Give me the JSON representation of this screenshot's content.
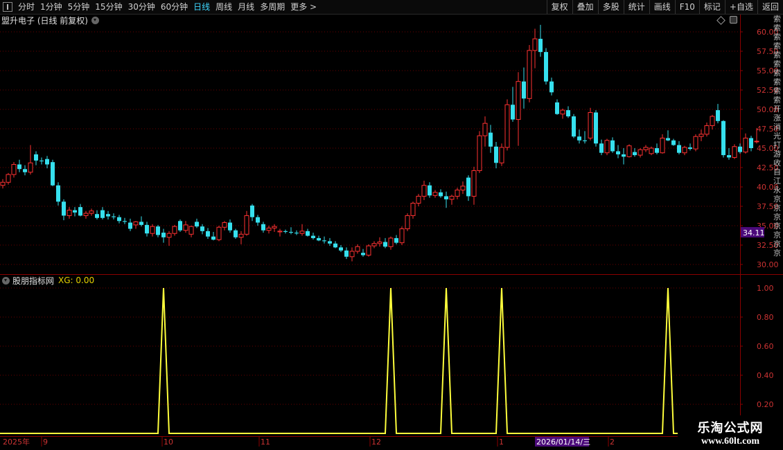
{
  "toolbar": {
    "periods": [
      "分时",
      "1分钟",
      "5分钟",
      "15分钟",
      "30分钟",
      "60分钟",
      "日线",
      "周线",
      "月线",
      "多周期",
      "更多 >"
    ],
    "active_period": "日线",
    "right_buttons": [
      "复权",
      "叠加",
      "多股",
      "统计",
      "画线",
      "F10",
      "标记",
      "+自选",
      "返回"
    ]
  },
  "chart_header": {
    "title": "盟升电子 (日线 前复权)"
  },
  "indicator_header": {
    "name": "股朋指标网",
    "value_text": "XG: 0.00"
  },
  "price_axis": {
    "ticks": [
      "60.00",
      "57.50",
      "55.00",
      "52.50",
      "50.00",
      "47.50",
      "45.00",
      "42.50",
      "40.00",
      "37.50",
      "35.00",
      "32.50",
      "30.00"
    ],
    "current_price": "34.11"
  },
  "indicator_axis": {
    "ticks": [
      "1.00",
      "0.80",
      "0.60",
      "0.40",
      "0.20"
    ]
  },
  "time_axis": {
    "labels": [
      "2025年",
      "9",
      "10",
      "11",
      "12",
      "1",
      "2"
    ],
    "cursor_date": "2026/01/14/三"
  },
  "right_strip": {
    "text": "索索索索索索索索索索开涨消光打游收自江永京京京京京京京"
  },
  "watermark": {
    "line1": "乐淘公式网",
    "line2": "www.60lt.com"
  },
  "colors": {
    "up": "#ff3232",
    "down": "#36e0ee",
    "indicator_line": "#ffff3c",
    "grid": "#6b0000",
    "axis_text": "#cc3333",
    "cursor_box": "#4b0a7a"
  },
  "chart_data": [
    {
      "type": "candlestick",
      "title": "盟升电子 (日线 前复权)",
      "ylim": [
        30,
        60
      ],
      "candles": [
        [
          40.2,
          41.0,
          39.8,
          40.6
        ],
        [
          40.6,
          41.8,
          40.3,
          41.6
        ],
        [
          41.6,
          43.2,
          41.2,
          42.9
        ],
        [
          42.9,
          43.5,
          41.9,
          42.3
        ],
        [
          42.3,
          42.8,
          41.5,
          41.9
        ],
        [
          41.9,
          45.4,
          41.6,
          43.1
        ],
        [
          44.2,
          44.6,
          42.8,
          43.4
        ],
        [
          43.4,
          43.8,
          42.9,
          43.3
        ],
        [
          43.6,
          44.0,
          42.4,
          42.9
        ],
        [
          43.2,
          43.5,
          40.1,
          40.2
        ],
        [
          40.2,
          40.6,
          37.6,
          38.1
        ],
        [
          38.1,
          38.4,
          35.7,
          36.3
        ],
        [
          36.3,
          37.4,
          35.9,
          37.0
        ],
        [
          37.0,
          37.4,
          36.2,
          36.7
        ],
        [
          37.4,
          37.8,
          36.2,
          36.3
        ],
        [
          36.3,
          36.9,
          35.9,
          36.6
        ],
        [
          36.6,
          37.2,
          36.3,
          36.9
        ],
        [
          36.5,
          37.0,
          35.8,
          36.0
        ],
        [
          37.0,
          37.4,
          35.8,
          36.0
        ],
        [
          36.5,
          36.9,
          35.8,
          36.2
        ],
        [
          36.2,
          36.6,
          35.8,
          36.1
        ],
        [
          36.1,
          36.4,
          35.3,
          35.6
        ],
        [
          35.6,
          36.0,
          35.2,
          35.5
        ],
        [
          35.4,
          35.9,
          34.3,
          34.6
        ],
        [
          35.1,
          35.6,
          34.6,
          35.5
        ],
        [
          35.5,
          36.2,
          34.9,
          35.1
        ],
        [
          35.1,
          35.5,
          33.6,
          34.0
        ],
        [
          34.0,
          35.2,
          33.6,
          34.9
        ],
        [
          34.9,
          35.1,
          33.5,
          33.8
        ],
        [
          34.1,
          34.6,
          32.8,
          33.5
        ],
        [
          33.5,
          34.3,
          32.4,
          34.0
        ],
        [
          34.0,
          35.1,
          33.7,
          34.9
        ],
        [
          35.6,
          35.8,
          34.2,
          34.4
        ],
        [
          34.4,
          35.6,
          34.1,
          35.1
        ],
        [
          33.9,
          35.0,
          33.5,
          34.9
        ],
        [
          35.5,
          35.9,
          34.7,
          34.9
        ],
        [
          34.9,
          35.2,
          33.9,
          34.3
        ],
        [
          34.3,
          34.7,
          33.3,
          33.6
        ],
        [
          33.6,
          34.2,
          33.1,
          33.2
        ],
        [
          33.2,
          35.0,
          33.0,
          34.8
        ],
        [
          34.8,
          35.6,
          34.4,
          35.4
        ],
        [
          35.4,
          35.8,
          34.1,
          34.4
        ],
        [
          34.4,
          34.6,
          33.3,
          33.5
        ],
        [
          33.5,
          34.3,
          32.6,
          33.9
        ],
        [
          33.9,
          36.9,
          33.7,
          36.3
        ],
        [
          37.6,
          37.8,
          35.6,
          36.1
        ],
        [
          36.1,
          36.4,
          35.0,
          35.4
        ],
        [
          35.2,
          35.5,
          34.1,
          34.4
        ],
        [
          34.4,
          35.0,
          34.0,
          34.7
        ],
        [
          34.7,
          35.2,
          34.2,
          34.9
        ],
        [
          34.2,
          34.6,
          33.6,
          34.3
        ],
        [
          34.3,
          34.5,
          34.0,
          34.2
        ],
        [
          34.2,
          34.8,
          33.9,
          34.1
        ],
        [
          34.1,
          34.4,
          33.8,
          34.0
        ],
        [
          34.0,
          35.2,
          33.7,
          34.3
        ],
        [
          34.3,
          34.6,
          33.6,
          33.7
        ],
        [
          33.7,
          34.1,
          33.2,
          33.4
        ],
        [
          33.4,
          33.7,
          33.0,
          33.1
        ],
        [
          33.1,
          33.6,
          32.7,
          33.0
        ],
        [
          33.0,
          33.4,
          32.4,
          32.7
        ],
        [
          32.7,
          33.0,
          32.1,
          32.2
        ],
        [
          32.2,
          32.5,
          31.6,
          31.8
        ],
        [
          31.8,
          32.2,
          30.7,
          31.0
        ],
        [
          31.0,
          32.2,
          30.4,
          31.7
        ],
        [
          31.7,
          32.6,
          31.4,
          32.3
        ],
        [
          31.5,
          32.0,
          31.0,
          31.2
        ],
        [
          31.2,
          32.6,
          31.0,
          32.4
        ],
        [
          32.4,
          33.0,
          32.1,
          32.7
        ],
        [
          32.7,
          33.5,
          32.3,
          32.9
        ],
        [
          32.9,
          33.4,
          32.1,
          32.3
        ],
        [
          32.3,
          33.6,
          31.9,
          33.4
        ],
        [
          33.4,
          33.8,
          32.6,
          32.8
        ],
        [
          32.8,
          34.9,
          32.5,
          34.6
        ],
        [
          34.6,
          36.6,
          34.3,
          36.3
        ],
        [
          36.3,
          38.1,
          35.9,
          37.9
        ],
        [
          37.9,
          39.1,
          37.5,
          38.8
        ],
        [
          38.8,
          40.8,
          38.3,
          40.2
        ],
        [
          40.2,
          40.6,
          38.6,
          38.9
        ],
        [
          38.9,
          39.6,
          38.6,
          39.3
        ],
        [
          39.3,
          39.7,
          38.6,
          38.8
        ],
        [
          38.8,
          39.4,
          37.3,
          38.4
        ],
        [
          38.4,
          39.0,
          37.7,
          38.8
        ],
        [
          38.8,
          39.9,
          38.4,
          39.6
        ],
        [
          39.6,
          40.7,
          39.1,
          40.1
        ],
        [
          41.2,
          41.5,
          38.2,
          38.8
        ],
        [
          38.8,
          42.6,
          37.7,
          42.1
        ],
        [
          42.1,
          47.2,
          41.8,
          46.6
        ],
        [
          46.6,
          49.1,
          45.2,
          48.2
        ],
        [
          47.0,
          48.0,
          44.4,
          45.2
        ],
        [
          45.2,
          45.8,
          42.4,
          43.1
        ],
        [
          43.1,
          45.6,
          42.7,
          45.1
        ],
        [
          45.1,
          51.3,
          44.7,
          50.6
        ],
        [
          50.6,
          52.9,
          48.4,
          48.7
        ],
        [
          48.7,
          54.8,
          45.3,
          53.6
        ],
        [
          53.6,
          55.4,
          50.1,
          51.4
        ],
        [
          51.4,
          58.3,
          50.9,
          57.6
        ],
        [
          57.6,
          60.4,
          55.3,
          59.1
        ],
        [
          59.1,
          60.9,
          56.8,
          57.4
        ],
        [
          57.4,
          57.9,
          53.2,
          53.6
        ],
        [
          53.6,
          54.1,
          51.8,
          52.2
        ],
        [
          50.9,
          51.3,
          49.3,
          49.4
        ],
        [
          49.4,
          50.1,
          48.8,
          49.9
        ],
        [
          49.9,
          50.4,
          48.9,
          49.1
        ],
        [
          49.1,
          49.4,
          46.3,
          46.5
        ],
        [
          46.5,
          47.4,
          45.6,
          46.0
        ],
        [
          46.0,
          47.2,
          45.6,
          45.9
        ],
        [
          46.3,
          50.2,
          46.0,
          49.6
        ],
        [
          49.6,
          49.9,
          45.2,
          45.6
        ],
        [
          45.6,
          46.1,
          44.1,
          44.4
        ],
        [
          44.4,
          46.2,
          44.1,
          46.0
        ],
        [
          46.0,
          46.4,
          44.4,
          44.6
        ],
        [
          44.6,
          45.4,
          43.7,
          44.2
        ],
        [
          44.2,
          45.0,
          42.9,
          43.9
        ],
        [
          43.9,
          45.5,
          43.8,
          45.3
        ],
        [
          44.5,
          45.0,
          43.9,
          44.1
        ],
        [
          44.1,
          45.0,
          43.8,
          44.8
        ],
        [
          44.8,
          45.4,
          44.5,
          45.1
        ],
        [
          44.3,
          45.2,
          44.1,
          45.0
        ],
        [
          45.0,
          45.6,
          44.2,
          44.4
        ],
        [
          44.4,
          46.8,
          44.3,
          46.3
        ],
        [
          46.3,
          47.3,
          45.9,
          46.0
        ],
        [
          46.0,
          46.2,
          45.3,
          45.4
        ],
        [
          45.4,
          45.9,
          44.2,
          44.4
        ],
        [
          44.4,
          45.3,
          44.1,
          45.1
        ],
        [
          45.1,
          45.6,
          44.7,
          44.9
        ],
        [
          44.9,
          46.8,
          44.6,
          46.5
        ],
        [
          46.5,
          47.4,
          45.9,
          46.8
        ],
        [
          46.8,
          48.3,
          46.5,
          47.9
        ],
        [
          47.9,
          49.3,
          47.4,
          49.1
        ],
        [
          49.9,
          50.7,
          48.2,
          48.5
        ],
        [
          48.5,
          48.6,
          43.8,
          44.1
        ],
        [
          44.1,
          45.0,
          43.5,
          43.8
        ],
        [
          43.8,
          45.5,
          43.6,
          45.2
        ],
        [
          45.2,
          45.6,
          44.3,
          44.5
        ],
        [
          44.5,
          46.9,
          44.3,
          46.3
        ],
        [
          46.3,
          46.6,
          44.6,
          45.0
        ],
        [
          45.9,
          47.6,
          45.6,
          45.9
        ]
      ]
    },
    {
      "type": "line",
      "title": "股朋指标网",
      "series": [
        {
          "name": "XG",
          "values": [
            0,
            0,
            0,
            0,
            0,
            0,
            0,
            0,
            0,
            0,
            0,
            0,
            0,
            0,
            0,
            0,
            0,
            0,
            0,
            0,
            0,
            0,
            0,
            0,
            0,
            0,
            0,
            0,
            0,
            1,
            0,
            0,
            0,
            0,
            0,
            0,
            0,
            0,
            0,
            0,
            0,
            0,
            0,
            0,
            0,
            0,
            0,
            0,
            0,
            0,
            0,
            0,
            0,
            0,
            0,
            0,
            0,
            0,
            0,
            0,
            0,
            0,
            0,
            0,
            0,
            0,
            0,
            0,
            0,
            0,
            1,
            0,
            0,
            0,
            0,
            0,
            0,
            0,
            0,
            0,
            1,
            0,
            0,
            0,
            0,
            0,
            0,
            0,
            0,
            0,
            1,
            0,
            0,
            0,
            0,
            0,
            0,
            0,
            0,
            0,
            0,
            0,
            0,
            0,
            0,
            0,
            0,
            0,
            0,
            0,
            0,
            0,
            0,
            0,
            0,
            0,
            0,
            0,
            0,
            0,
            1,
            0,
            0,
            0,
            0,
            0,
            0,
            0,
            0,
            0,
            0,
            0,
            0,
            0,
            0,
            0,
            0
          ]
        }
      ],
      "ylim": [
        0,
        1
      ]
    }
  ]
}
